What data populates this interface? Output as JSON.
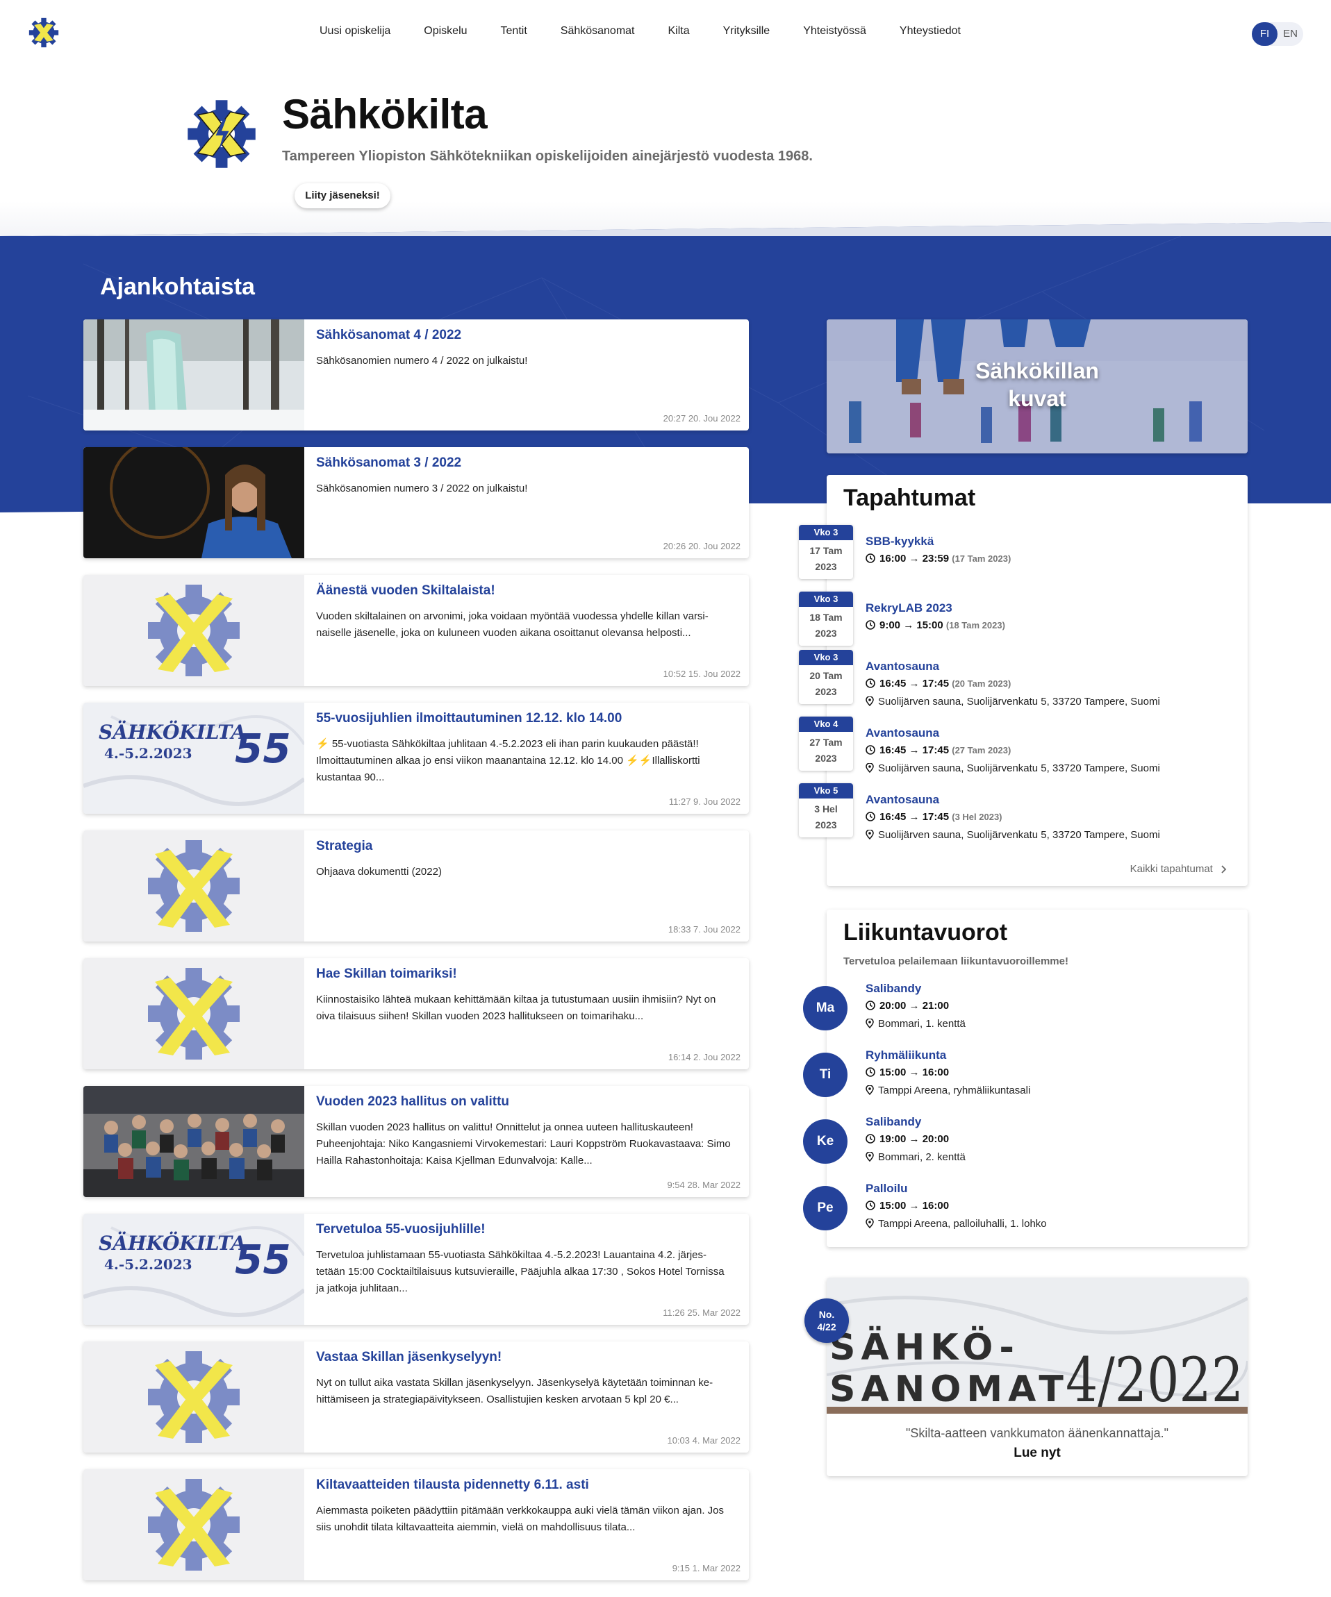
{
  "nav": {
    "items": [
      "Uusi opiskelija",
      "Opiskelu",
      "Tentit",
      "Sähkösanomat",
      "Kilta",
      "Yrityksille",
      "Yhteistyössä",
      "Yhteystiedot"
    ],
    "lang_fi": "FI",
    "lang_en": "EN"
  },
  "hero": {
    "title": "Sähkökilta",
    "subtitle": "Tampereen Yliopiston Sähkötekniikan opiskelijoiden ainejärjestö vuodesta 1968.",
    "join": "Liity jäseneksi!"
  },
  "news": {
    "heading": "Ajankohtaista",
    "items": [
      {
        "title": "Sähkösanomat 4 / 2022",
        "text": "Sähkösanomien numero 4 / 2022 on julkaistu!",
        "date": "20:27 20. Jou 2022",
        "thumb": "winter-ice-photo"
      },
      {
        "title": "Sähkösanomat 3 / 2022",
        "text": "Sähkösanomien numero 3 / 2022 on julkaistu!",
        "date": "20:26 20. Jou 2022",
        "thumb": "person-photo"
      },
      {
        "title": "Äänestä vuoden Skiltalaista!",
        "text": "Vuoden skiltalainen on arvonimi, joka voidaan myöntää vuodessa yhdelle killan varsi-naiselle jäsenelle, joka on kuluneen vuoden aikana osoittanut olevansa helposti...",
        "date": "10:52 15. Jou 2022",
        "thumb": "guild-logo"
      },
      {
        "title": "55-vuosijuhlien ilmoittautuminen 12.12. klo 14.00",
        "text": "⚡️ 55-vuotiasta Sähkökiltaa juhlitaan 4.-5.2.2023 eli ihan parin kuukauden päästä!! Ilmoittautuminen alkaa jo ensi viikon maanantaina 12.12. klo 14.00 ⚡️⚡️Illalliskortti kustantaa 90...",
        "date": "11:27 9. Jou 2022",
        "thumb": "anniversary-banner"
      },
      {
        "title": "Strategia",
        "text": "Ohjaava dokumentti (2022)",
        "date": "18:33 7. Jou 2022",
        "thumb": "guild-logo"
      },
      {
        "title": "Hae Skillan toimariksi!",
        "text": "Kiinnostaisiko lähteä mukaan kehittämään kiltaa ja tutustumaan uusiin ihmisiin? Nyt on oiva tilaisuus siihen! Skillan vuoden 2023 hallitukseen on toimarihaku...",
        "date": "16:14 2. Jou 2022",
        "thumb": "guild-logo"
      },
      {
        "title": "Vuoden 2023 hallitus on valittu",
        "text": "Skillan vuoden 2023 hallitus on valittu! Onnittelut ja onnea uuteen hallituskauteen! Puheenjohtaja: Niko Kangasniemi Virvokemestari: Lauri Koppström Ruokavastaava: Simo Hailla Rahastonhoitaja: Kaisa Kjellman Edunvalvoja: Kalle...",
        "date": "9:54 28. Mar 2022",
        "thumb": "group-photo"
      },
      {
        "title": "Tervetuloa 55-vuosijuhlille!",
        "text": "Tervetuloa juhlistamaan 55-vuotiasta Sähkökiltaa 4.-5.2.2023! Lauantaina 4.2. järjes-tetään 15:00 Cocktailtilaisuus kutsuvieraille, Pääjuhla alkaa 17:30 , Sokos Hotel Tornissa ja jatkoja juhlitaan...",
        "date": "11:26 25. Mar 2022",
        "thumb": "anniversary-banner"
      },
      {
        "title": "Vastaa Skillan jäsenkyselyyn!",
        "text": "Nyt on tullut aika vastata Skillan jäsenkyselyyn. Jäsenkyselyä käytetään toiminnan ke-hittämiseen ja strategiapäivitykseen. Osallistujien kesken arvotaan 5 kpl 20 €...",
        "date": "10:03 4. Mar 2022",
        "thumb": "guild-logo"
      },
      {
        "title": "Kiltavaatteiden tilausta pidennetty 6.11. asti",
        "text": "Aiemmasta poiketen päädyttiin pitämään verkkokauppa auki vielä tämän viikon ajan. Jos siis unohdit tilata kiltavaatteita aiemmin, vielä on mahdollisuus tilata...",
        "date": "9:15 1. Mar 2022",
        "thumb": "guild-logo"
      }
    ]
  },
  "banner_text": {
    "line1": "SÄHKÖKILTA",
    "line2": "4.-5.2.2023",
    "num": "55"
  },
  "photos": {
    "label_line1": "Sähkökillan",
    "label_line2": "kuvat"
  },
  "events": {
    "heading": "Tapahtumat",
    "items": [
      {
        "week": "Vko 3",
        "day": "17 Tam",
        "year": "2023",
        "title": "SBB-kyykkä",
        "time": "16:00 → 23:59",
        "date_note": "(17 Tam 2023)",
        "place": ""
      },
      {
        "week": "Vko 3",
        "day": "18 Tam",
        "year": "2023",
        "title": "RekryLAB 2023",
        "time": "9:00 → 15:00",
        "date_note": "(18 Tam 2023)",
        "place": ""
      },
      {
        "week": "Vko 3",
        "day": "20 Tam",
        "year": "2023",
        "title": "Avantosauna",
        "time": "16:45 → 17:45",
        "date_note": "(20 Tam 2023)",
        "place": "Suolijärven sauna, Suolijärvenkatu 5, 33720 Tampere, Suomi"
      },
      {
        "week": "Vko 4",
        "day": "27 Tam",
        "year": "2023",
        "title": "Avantosauna",
        "time": "16:45 → 17:45",
        "date_note": "(27 Tam 2023)",
        "place": "Suolijärven sauna, Suolijärvenkatu 5, 33720 Tampere, Suomi"
      },
      {
        "week": "Vko 5",
        "day": "3 Hel",
        "year": "2023",
        "title": "Avantosauna",
        "time": "16:45 → 17:45",
        "date_note": "(3 Hel 2023)",
        "place": "Suolijärven sauna, Suolijärvenkatu 5, 33720 Tampere, Suomi"
      }
    ],
    "all_link": "Kaikki tapahtumat"
  },
  "sports": {
    "heading": "Liikuntavuorot",
    "subtitle": "Tervetuloa pelailemaan liikuntavuoroillemme!",
    "items": [
      {
        "day": "Ma",
        "title": "Salibandy",
        "time": "20:00 → 21:00",
        "place": "Bommari, 1. kenttä"
      },
      {
        "day": "Ti",
        "title": "Ryhmäliikunta",
        "time": "15:00 → 16:00",
        "place": "Tamppi Areena, ryhmäliikuntasali"
      },
      {
        "day": "Ke",
        "title": "Salibandy",
        "time": "19:00 → 20:00",
        "place": "Bommari, 2. kenttä"
      },
      {
        "day": "Pe",
        "title": "Palloilu",
        "time": "15:00 → 16:00",
        "place": "Tamppi Areena, palloiluhalli, 1. lohko"
      }
    ]
  },
  "magazine": {
    "badge_line1": "No.",
    "badge_line2": "4/22",
    "cover_line1": "SÄHKÖ-",
    "cover_line2": "SANOMAT",
    "cover_issue": "4/2022",
    "quote": "\"Skilta-aatteen vankkumaton äänenkannattaja.\"",
    "read": "Lue nyt"
  },
  "colors": {
    "brand_blue": "#24429a",
    "logo_yellow": "#f2e64a",
    "logo_gear": "#7c8cc6"
  }
}
